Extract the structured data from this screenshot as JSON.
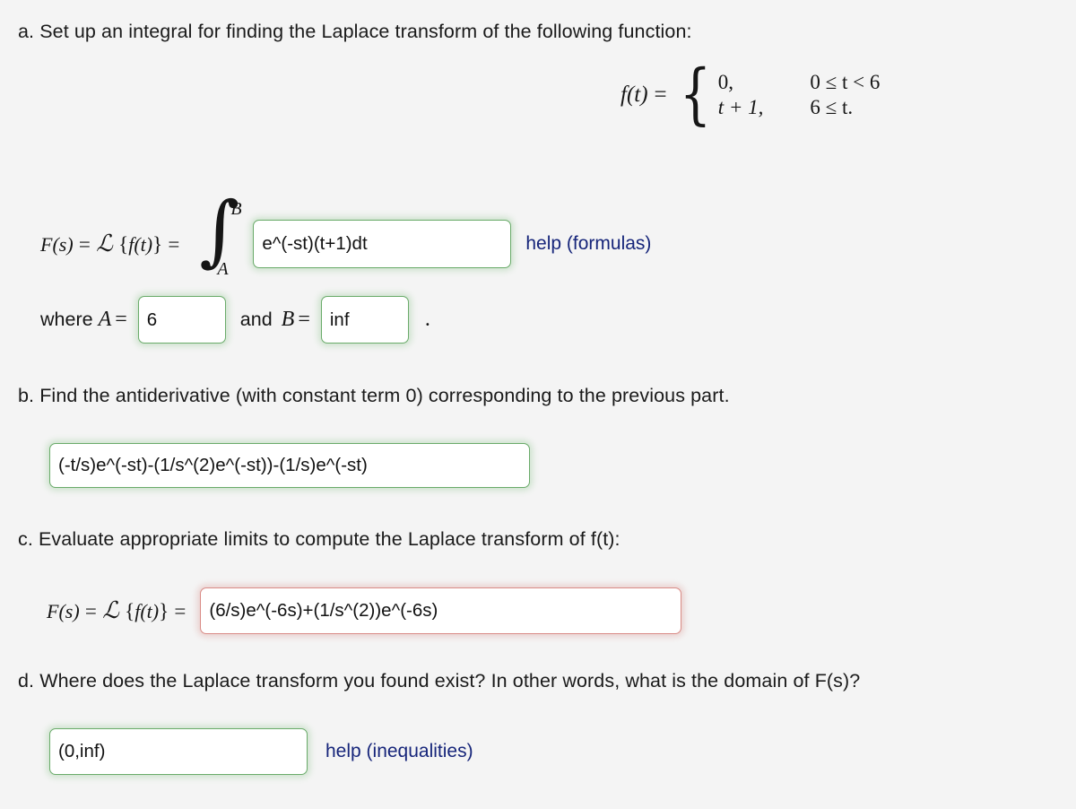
{
  "parts": {
    "a": {
      "prompt": "a. Set up an integral for finding the Laplace transform of the following function:",
      "piecewise": {
        "lhs": "f(t)",
        "equals": "=",
        "rows": [
          {
            "case": "0,",
            "condition_lhs": "0 ≤ t",
            "condition_rhs": "< 6",
            "condition": "0 ≤ t < 6"
          },
          {
            "case": "t + 1,",
            "condition_lhs": "6 ≤ t",
            "condition_rhs": ".",
            "condition": "6 ≤ t."
          }
        ]
      },
      "integral_lhs": "F(s) = ℒ {f(t)} =",
      "integral_upper_limit": "B",
      "integral_lower_limit": "A",
      "integrand_value": "e^(-st)(t+1)dt",
      "integrand_placeholder": "",
      "help_link": "help (formulas)",
      "where_label": "where",
      "var_a": "A",
      "var_b": "B",
      "equals_sign": "=",
      "conjunction": "and",
      "a_value": "6",
      "b_value": "inf",
      "trailing_period": "."
    },
    "b": {
      "prompt": "b. Find the antiderivative (with constant term 0) corresponding to the previous part.",
      "antiderivative_value": "(-t/s)e^(-st)-(1/s^(2)e^(-st))-(1/s)e^(-st)"
    },
    "c": {
      "prompt": "c. Evaluate appropriate limits to compute the Laplace transform of f(t):",
      "transform_lhs": "F(s) = ℒ {f(t)} =",
      "transform_value": "(6/s)e^(-6s)+(1/s^(2))e^(-6s)"
    },
    "d": {
      "prompt": "d. Where does the Laplace transform you found exist? In other words, what is the domain of F(s)?",
      "domain_value": "(0,inf)",
      "help_link": "help (inequalities)"
    }
  },
  "math_symbols": {
    "F": "F",
    "s_paren_open": "(",
    "s": "s",
    "s_paren_close": ")",
    "equals": "=",
    "script_L": "ℒ",
    "brace_open": "{",
    "f": "f",
    "t_paren_open": "(",
    "t": "t",
    "t_paren_close": ")",
    "brace_close": "}",
    "integral": "∫",
    "left_brace_big": "{"
  },
  "colors": {
    "page_background": "#f4f4f4",
    "text": "#1a1a1a",
    "field_border_correct": "#6aab6a",
    "field_border_incorrect": "#d98b86",
    "field_background": "#ffffff",
    "link": "#16257a"
  }
}
